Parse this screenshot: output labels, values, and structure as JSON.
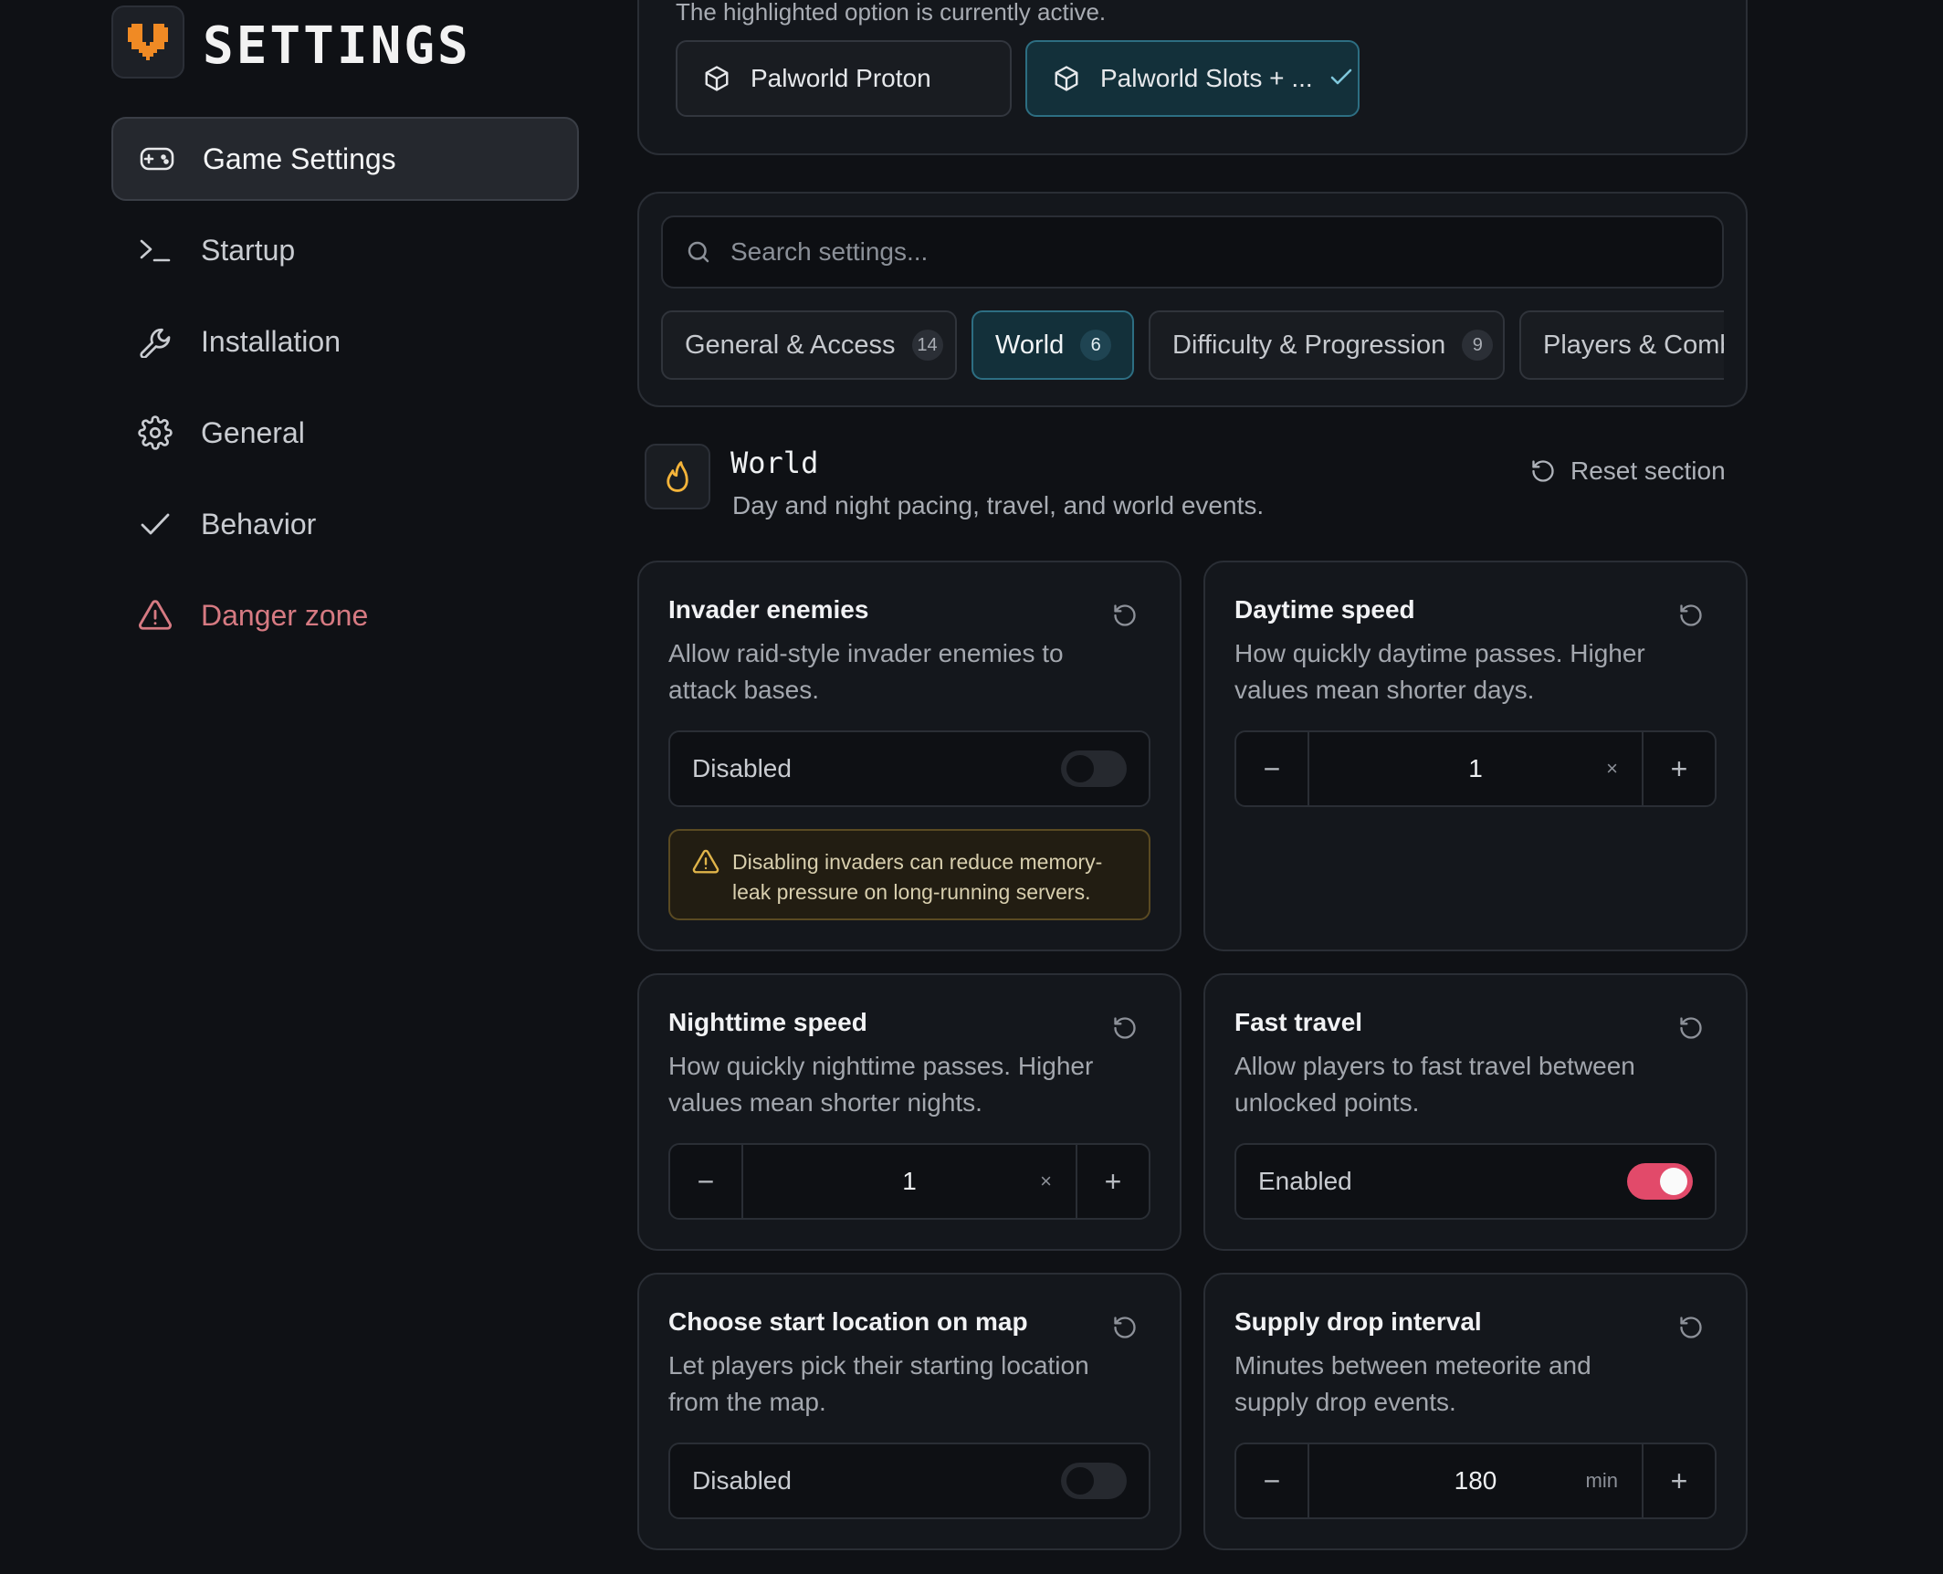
{
  "brand": {
    "title": "SETTINGS",
    "logo_icon": "heart-logo"
  },
  "sidebar": {
    "items": [
      {
        "label": "Game Settings",
        "icon": "gamepad-icon",
        "active": true
      },
      {
        "label": "Startup",
        "icon": "terminal-icon"
      },
      {
        "label": "Installation",
        "icon": "wrench-icon"
      },
      {
        "label": "General",
        "icon": "gear-icon"
      },
      {
        "label": "Behavior",
        "icon": "check-icon"
      },
      {
        "label": "Danger zone",
        "icon": "warning-icon",
        "danger": true
      }
    ]
  },
  "servers": {
    "hint": "The highlighted option is currently active.",
    "options": [
      {
        "label": "Palworld Proton",
        "icon": "cube-icon",
        "active": false
      },
      {
        "label": "Palworld Slots + ...",
        "icon": "cube-icon",
        "active": true
      }
    ]
  },
  "search": {
    "placeholder": "Search settings...",
    "value": ""
  },
  "tabs": [
    {
      "label": "General & Access",
      "count": "14"
    },
    {
      "label": "World",
      "count": "6",
      "active": true
    },
    {
      "label": "Difficulty & Progression",
      "count": "9"
    },
    {
      "label": "Players & Combat",
      "count": ""
    }
  ],
  "section": {
    "title": "World",
    "description": "Day and night pacing, travel, and world events.",
    "reset_label": "Reset section",
    "icon": "flame-icon"
  },
  "cards": {
    "invader": {
      "title": "Invader enemies",
      "description": "Allow raid-style invader enemies to attack bases.",
      "state_label": "Disabled",
      "enabled": false,
      "warning": "Disabling invaders can reduce memory-leak pressure on long-running servers."
    },
    "daytime": {
      "title": "Daytime speed",
      "description": "How quickly daytime passes. Higher values mean shorter days.",
      "value": "1",
      "unit": "×"
    },
    "nighttime": {
      "title": "Nighttime speed",
      "description": "How quickly nighttime passes. Higher values mean shorter nights.",
      "value": "1",
      "unit": "×"
    },
    "fast_travel": {
      "title": "Fast travel",
      "description": "Allow players to fast travel between unlocked points.",
      "state_label": "Enabled",
      "enabled": true
    },
    "start_location": {
      "title": "Choose start location on map",
      "description": "Let players pick their starting location from the map.",
      "state_label": "Disabled",
      "enabled": false
    },
    "supply_drop": {
      "title": "Supply drop interval",
      "description": "Minutes between meteorite and supply drop events.",
      "value": "180",
      "unit": "min"
    }
  },
  "colors": {
    "accent_active": "#2d6e82",
    "toggle_on": "#e24a6a",
    "danger": "#d67a82",
    "brand_orange": "#f08a24"
  }
}
